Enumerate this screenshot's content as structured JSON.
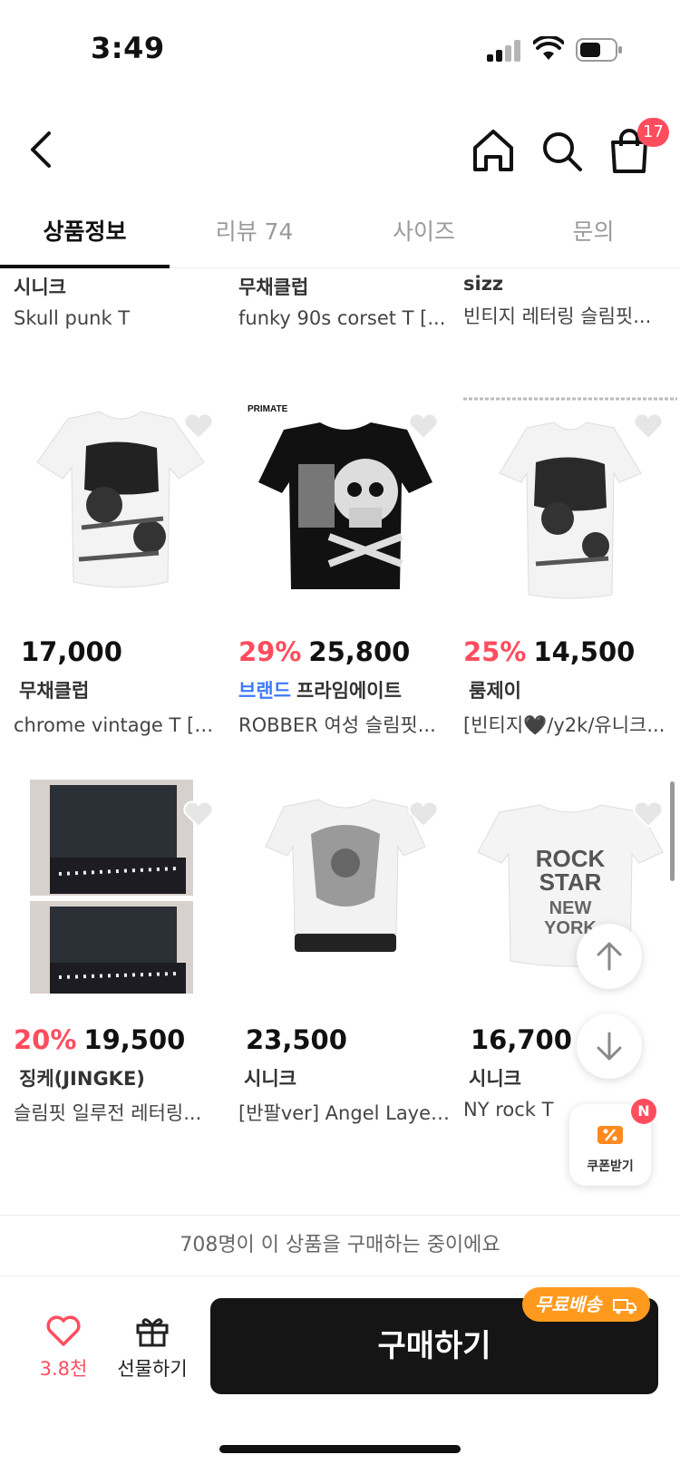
{
  "status": {
    "time": "3:49"
  },
  "nav": {
    "cart_count": "17"
  },
  "tabs": [
    {
      "label": "상품정보"
    },
    {
      "label": "리뷰 74"
    },
    {
      "label": "사이즈"
    },
    {
      "label": "문의"
    }
  ],
  "top_row": [
    {
      "brand": "시니크",
      "name": "Skull punk T"
    },
    {
      "brand": "무채클럽",
      "name": "funky 90s corset T [..."
    },
    {
      "brand": "sizz",
      "name": "빈티지 레터링 슬림핏..."
    }
  ],
  "products": [
    {
      "discount": "",
      "price": "17,000",
      "brand_tag": "",
      "brand": "무채클럽",
      "name": "chrome vintage T [크..."
    },
    {
      "discount": "29%",
      "price": "25,800",
      "brand_tag": "브랜드",
      "brand": "프라임에이트",
      "name": "ROBBER 여성 슬림핏..."
    },
    {
      "discount": "25%",
      "price": "14,500",
      "brand_tag": "",
      "brand": "룸제이",
      "name": "[빈티지🖤/y2k/유니크..."
    },
    {
      "discount": "20%",
      "price": "19,500",
      "brand_tag": "",
      "brand": "징케(JINGKE)",
      "name": "슬림핏 일루전 레터링..."
    },
    {
      "discount": "",
      "price": "23,500",
      "brand_tag": "",
      "brand": "시니크",
      "name": "[반팔ver] Angel Layer..."
    },
    {
      "discount": "",
      "price": "16,700",
      "brand_tag": "",
      "brand": "시니크",
      "name": "NY rock T"
    }
  ],
  "thumb_text": {
    "primate": "PRIMATE",
    "rockstar_1": "ROCK",
    "rockstar_2": "STAR",
    "rockstar_3": "NEW",
    "rockstar_4": "YORK"
  },
  "coupon": {
    "label": "쿠폰받기",
    "badge": "N"
  },
  "notice": "708명이 이 상품을 구매하는 중이에요",
  "bottom": {
    "like_count": "3.8천",
    "gift_label": "선물하기",
    "buy_label": "구매하기",
    "free_shipping": "무료배송"
  },
  "colors": {
    "accent": "#ff4d5e",
    "brand_blue": "#3d7bff",
    "free_ship": "#ff9a1f"
  }
}
